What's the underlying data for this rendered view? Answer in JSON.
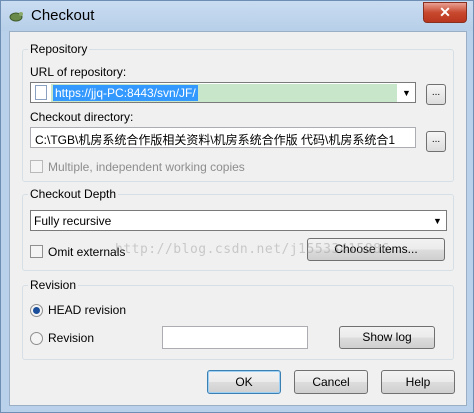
{
  "window": {
    "title": "Checkout",
    "close_glyph": "✕"
  },
  "repository": {
    "legend": "Repository",
    "url_label": "URL of repository:",
    "url_value": "https://jjq-PC:8443/svn/JF/",
    "browse_label": "...",
    "dir_label": "Checkout directory:",
    "dir_value": "C:\\TGB\\机房系统合作版相关资料\\机房系统合作版 代码\\机房系统合1",
    "dir_browse_label": "...",
    "multiple_label": "Multiple, independent working copies"
  },
  "depth": {
    "legend": "Checkout Depth",
    "selected": "Fully recursive",
    "omit_label": "Omit externals",
    "choose_items_label": "Choose items..."
  },
  "revision": {
    "legend": "Revision",
    "head_label": "HEAD revision",
    "revision_label": "Revision",
    "revision_value": "",
    "show_log_label": "Show log"
  },
  "footer": {
    "ok_label": "OK",
    "cancel_label": "Cancel",
    "help_label": "Help"
  },
  "watermark": "http://blog.csdn.net/j15533415886",
  "colors": {
    "title_gradient": "#c9dcf1",
    "selection": "#3399ff",
    "close_button": "#c8492f"
  }
}
